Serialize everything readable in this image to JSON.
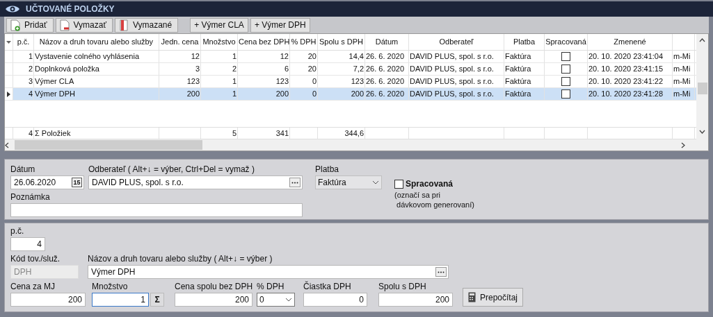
{
  "title": "UČTOVANÉ POLOŽKY",
  "toolbar": [
    {
      "label": "Pridať",
      "kind": "add"
    },
    {
      "label": "Vymazať",
      "kind": "remove"
    },
    {
      "label": "Vymazané",
      "kind": "deleted"
    },
    {
      "label": "+ Výmer CLA",
      "kind": "plain"
    },
    {
      "label": "+ Výmer DPH",
      "kind": "plain"
    }
  ],
  "columns": [
    "p.č.",
    "Názov a druh tovaru alebo služby",
    "Jedn. cena",
    "Množstvo",
    "Cena bez DPH",
    "% DPH",
    "Spolu s DPH",
    "Dátum",
    "Odberateľ",
    "Platba",
    "Spracovaná",
    "Zmenené"
  ],
  "rows": [
    {
      "number": "1",
      "name": "Vystavenie colného vyhlásenia",
      "unit_price": "12",
      "quantity": "1",
      "price_ex_vat": "12",
      "vat_pct": "20",
      "total": "14,4",
      "date": "26. 6. 2020",
      "customer": "DAVID PLUS, spol. s r.o.",
      "payment": "Faktúra",
      "processed": false,
      "changed": "20. 10. 2020 23:41:04",
      "column_13": "m-Mi",
      "selected": false
    },
    {
      "number": "2",
      "name": "Doplnková položka",
      "unit_price": "3",
      "quantity": "2",
      "price_ex_vat": "6",
      "vat_pct": "20",
      "total": "7,2",
      "date": "26. 6. 2020",
      "customer": "DAVID PLUS, spol. s r.o.",
      "payment": "Faktúra",
      "processed": false,
      "changed": "20. 10. 2020 23:41:15",
      "column_13": "m-Mi",
      "selected": false
    },
    {
      "number": "3",
      "name": "Výmer CLA",
      "unit_price": "123",
      "quantity": "1",
      "price_ex_vat": "123",
      "vat_pct": "0",
      "total": "123",
      "date": "26. 6. 2020",
      "customer": "DAVID PLUS, spol. s r.o.",
      "payment": "Faktúra",
      "processed": false,
      "changed": "20. 10. 2020 23:41:22",
      "column_13": "m-Mi",
      "selected": false
    },
    {
      "number": "4",
      "name": "Výmer DPH",
      "unit_price": "200",
      "quantity": "1",
      "price_ex_vat": "200",
      "vat_pct": "0",
      "total": "200",
      "date": "26. 6. 2020",
      "customer": "DAVID PLUS, spol. s r.o.",
      "payment": "Faktúra",
      "processed": false,
      "changed": "20. 10. 2020 23:41:28",
      "column_13": "m-Mi",
      "selected": true
    }
  ],
  "footer": {
    "number": "4",
    "name": "Σ Položiek",
    "quantity": "5",
    "price_ex_vat": "341",
    "total": "344,6"
  },
  "header_form": {
    "date_label": "Dátum",
    "date": "26.06.2020",
    "calendar_button": "15",
    "customer_label": "Odberateľ  ( Alt+↓ = výber, Ctrl+Del = vymaž )",
    "customer": "DAVID PLUS, spol. s r.o.",
    "payment_label": "Platba",
    "payment": "Faktúra",
    "processed_label": "Spracovaná",
    "processed": false,
    "processed_note": "(označí sa pri\n dávkovom generovaní)",
    "note_label": "Poznámka"
  },
  "item_form": {
    "number_label": "p.č.",
    "number": "4",
    "code_label": "Kód tov./služ.",
    "code": "DPH",
    "name_label": "Názov a druh tovaru alebo služby  ( Alt+↓ = výber )",
    "name": "Výmer DPH",
    "unit_price_label": "Cena za MJ",
    "unit_price": "200",
    "quantity_label": "Množstvo",
    "quantity": "1",
    "sum_button": "Σ",
    "price_ex_vat_label": "Cena spolu bez DPH",
    "price_ex_vat": "200",
    "vat_pct_label": "% DPH",
    "vat_pct": "0",
    "vat_amount_label": "Čiastka DPH",
    "vat_amount": "0",
    "total_label": "Spolu s DPH",
    "total": "200",
    "recalc_button": "Prepočítaj"
  }
}
